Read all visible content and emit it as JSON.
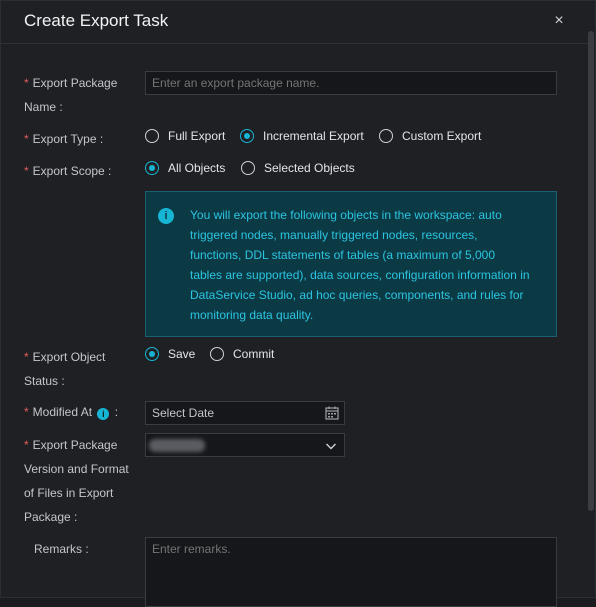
{
  "dialog": {
    "title": "Create Export Task",
    "close_glyph": "×"
  },
  "form": {
    "package_name": {
      "label": "Export Package Name :",
      "label_line1": "Export Package",
      "label_line2": "Name :",
      "placeholder": "Enter an export package name.",
      "value": ""
    },
    "export_type": {
      "label": "Export Type :",
      "options": [
        "Full Export",
        "Incremental Export",
        "Custom Export"
      ],
      "selected": "Incremental Export"
    },
    "export_scope": {
      "label": "Export Scope :",
      "options": [
        "All Objects",
        "Selected Objects"
      ],
      "selected": "All Objects"
    },
    "notice": {
      "icon": "info-icon",
      "text": "You will export the following objects in the workspace: auto triggered nodes, manually triggered nodes, resources, functions, DDL statements of tables (a maximum of 5,000 tables are supported), data sources, configuration information in DataService Studio, ad hoc queries, components, and rules for monitoring data quality."
    },
    "object_status": {
      "label_line1": "Export Object",
      "label_line2": "Status :",
      "options": [
        "Save",
        "Commit"
      ],
      "selected": "Save"
    },
    "modified_at": {
      "label": "Modified At",
      "label_suffix": ":",
      "placeholder": "Select Date",
      "icon": "calendar-icon"
    },
    "package_version": {
      "label_lines": [
        "Export Package",
        "Version and Format",
        "of Files in Export",
        "Package :"
      ],
      "selected_value": "",
      "icon": "chevron-down-icon"
    },
    "remarks": {
      "label": "Remarks :",
      "placeholder": "Enter remarks."
    }
  },
  "colors": {
    "accent": "#17b5d4",
    "required": "#e45b5b",
    "notice_bg": "#0b3a45",
    "notice_text": "#2cc4e0"
  }
}
